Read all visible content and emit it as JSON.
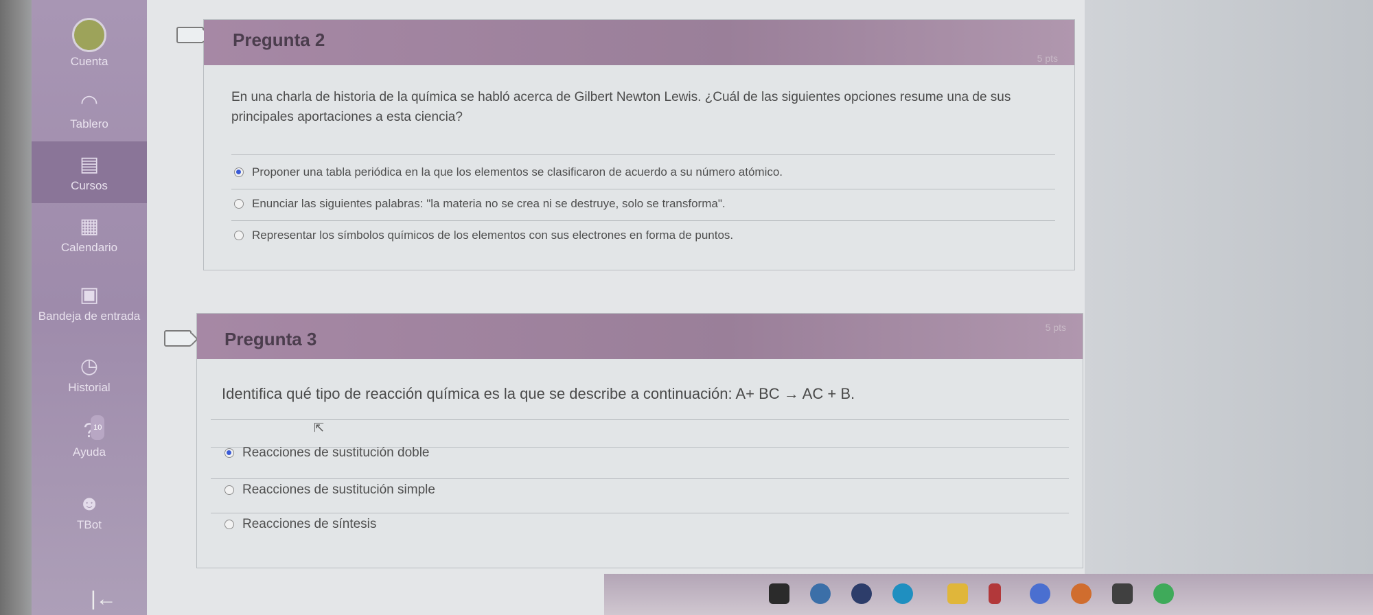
{
  "sidebar": {
    "items": [
      {
        "label": "Cuenta",
        "icon": "account-avatar"
      },
      {
        "label": "Tablero",
        "icon": "dashboard-gauge-icon"
      },
      {
        "label": "Cursos",
        "icon": "courses-book-icon"
      },
      {
        "label": "Calendario",
        "icon": "calendar-icon"
      },
      {
        "label": "Bandeja de entrada",
        "icon": "inbox-icon"
      },
      {
        "label": "Historial",
        "icon": "history-clock-icon"
      },
      {
        "label": "Ayuda",
        "icon": "help-icon",
        "badge": "10"
      },
      {
        "label": "TBot",
        "icon": "robot-icon"
      }
    ]
  },
  "questions": [
    {
      "title": "Pregunta 2",
      "points": "5 pts",
      "text": "En una charla de historia de la química se habló acerca de Gilbert Newton Lewis. ¿Cuál de las siguientes opciones resume una de sus principales aportaciones a esta ciencia?",
      "options": [
        {
          "label": "Proponer una tabla periódica en la que los elementos se clasificaron de acuerdo a su número atómico.",
          "selected": true
        },
        {
          "label": "Enunciar las siguientes palabras: \"la materia no se crea ni se destruye, solo se transforma\".",
          "selected": false
        },
        {
          "label": "Representar los símbolos químicos de los elementos con sus electrones en forma de puntos.",
          "selected": false
        }
      ]
    },
    {
      "title": "Pregunta 3",
      "points": "5 pts",
      "text": "Identifica qué tipo de reacción química es la que se describe a continuación: A+ BC → AC + B.",
      "options": [
        {
          "label": "Reacciones de sustitución doble",
          "selected": true
        },
        {
          "label": "Reacciones de sustitución simple",
          "selected": false
        },
        {
          "label": "Reacciones de síntesis",
          "selected": false
        }
      ]
    }
  ],
  "colors": {
    "sidebar": "#9e8bab",
    "card_header": "#a688a5",
    "radio_selected": "#3a5bd6"
  }
}
